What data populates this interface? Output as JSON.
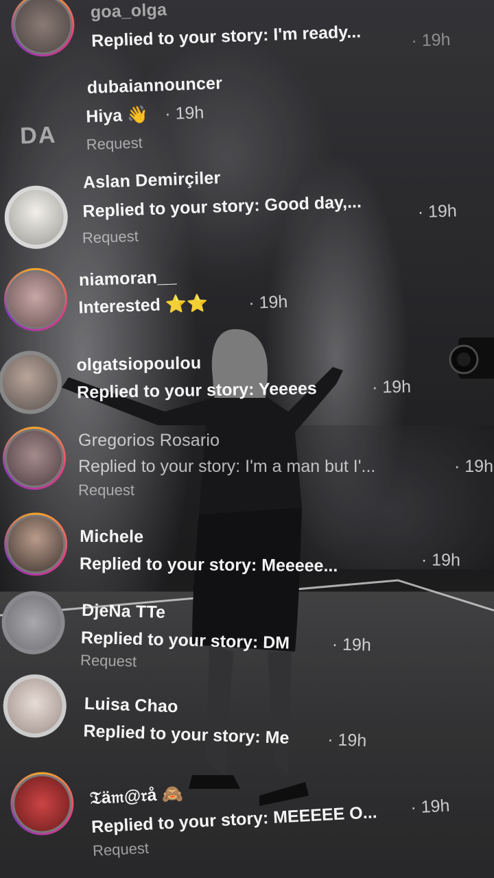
{
  "messages": [
    {
      "name": "goa_olga",
      "text": "Replied to your story: I'm ready...",
      "time": "· 19h",
      "request": ""
    },
    {
      "name": "dubaiannouncer",
      "text": "Hiya 👋",
      "time": "· 19h",
      "request": "Request",
      "avatar_text": "DA"
    },
    {
      "name": "Aslan Demirçiler",
      "text": "Replied to your story: Good day,...",
      "time": "· 19h",
      "request": "Request"
    },
    {
      "name": "niamoran__",
      "text": "Interested ⭐⭐",
      "time": "· 19h",
      "request": ""
    },
    {
      "name": "olgatsiopoulou",
      "text": "Replied to your story: Yeeees",
      "time": "· 19h",
      "request": ""
    },
    {
      "name": "Gregorios Rosario",
      "text": "Replied to your story: I'm a man but I'...",
      "time": "· 19h",
      "request": "Request"
    },
    {
      "name": "Michele",
      "text": "Replied to your story: Meeeee...",
      "time": "· 19h",
      "request": ""
    },
    {
      "name": "DjeNa TTe",
      "text": "Replied to your story: DM",
      "time": "· 19h",
      "request": "Request"
    },
    {
      "name": "Luisa Chao",
      "text": "Replied to your story: Me",
      "time": "· 19h",
      "request": ""
    },
    {
      "name": "𝔗ä𝔪@𝔯å 🙈",
      "text": "Replied to your story: MEEEEE O...",
      "time": "· 19h",
      "request": "Request"
    }
  ]
}
